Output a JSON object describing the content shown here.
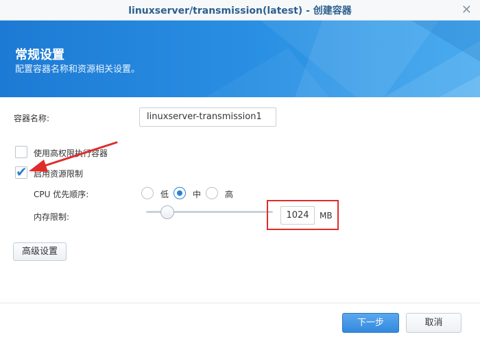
{
  "window": {
    "title": "linuxserver/transmission(latest) - 创建容器",
    "close_glyph": "✕"
  },
  "banner": {
    "title": "常规设置",
    "subtitle": "配置容器名称和资源相关设置。"
  },
  "form": {
    "container_name_label": "容器名称:",
    "container_name_value": "linuxserver-transmission1",
    "high_privilege_label": "使用高权限执行容器",
    "high_privilege_checked": false,
    "resource_limit_label": "启用资源限制",
    "resource_limit_checked": true,
    "cpu_priority_label": "CPU 优先顺序:",
    "cpu_options": [
      "低",
      "中",
      "高"
    ],
    "cpu_selected": "中",
    "memory_label": "内存限制:",
    "memory_value": "1024",
    "memory_unit": "MB",
    "memory_slider_fraction": 0.17
  },
  "buttons": {
    "advanced": "高级设置",
    "next": "下一步",
    "cancel": "取消"
  },
  "colors": {
    "accent": "#2a80d5",
    "highlight": "#e02b2b"
  }
}
